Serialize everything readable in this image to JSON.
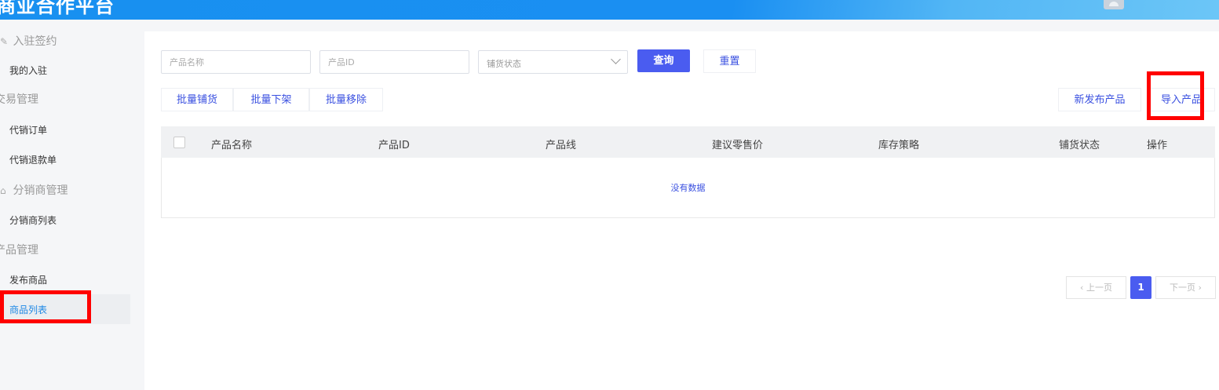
{
  "header": {
    "app_title": "商业合作平台",
    "avatar_icon": "avatar-icon"
  },
  "sidebar": {
    "groups": [
      {
        "label": "入驻签约",
        "icon": "sign-icon",
        "items": [
          {
            "label": "我的入驻"
          }
        ]
      },
      {
        "label": "交易管理",
        "icon": "",
        "items": [
          {
            "label": "代销订单"
          },
          {
            "label": "代销退款单"
          }
        ]
      },
      {
        "label": "分销商管理",
        "icon": "home-icon",
        "items": [
          {
            "label": "分销商列表"
          }
        ]
      },
      {
        "label": "产品管理",
        "icon": "",
        "items": [
          {
            "label": "发布商品"
          },
          {
            "label": "商品列表",
            "active": true
          }
        ]
      }
    ]
  },
  "filters": {
    "product_name_placeholder": "产品名称",
    "product_id_placeholder": "产品ID",
    "status_placeholder": "铺货状态",
    "search_label": "查询",
    "reset_label": "重置"
  },
  "toolbar": {
    "batch_distribute": "批量铺货",
    "batch_offshelf": "批量下架",
    "batch_remove": "批量移除",
    "new_product": "新发布产品",
    "import_product": "导入产品"
  },
  "table": {
    "columns": [
      "产品名称",
      "产品ID",
      "产品线",
      "建议零售价",
      "库存策略",
      "铺货状态",
      "操作"
    ],
    "empty_text": "没有数据"
  },
  "pagination": {
    "prev_label": "上一页",
    "next_label": "下一页",
    "current_page": "1"
  },
  "colors": {
    "primary": "#4a5cf0",
    "header_blue": "#1890f0",
    "highlight_red": "#ff0000",
    "active_text": "#1e88e5"
  }
}
